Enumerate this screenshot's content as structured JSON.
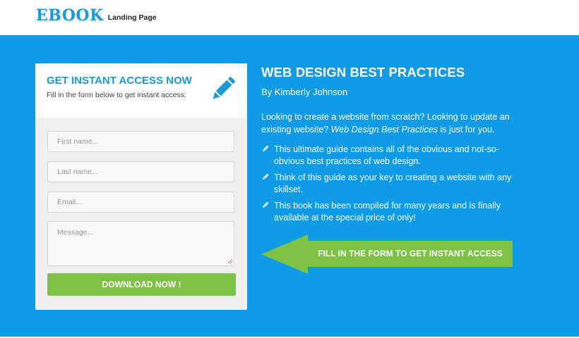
{
  "header": {
    "logo_main": "EBOOK",
    "logo_sub": "Landing Page"
  },
  "form": {
    "title": "GET INSTANT ACCESS NOW",
    "subtitle": "Fill in the form below to get instant access:",
    "first_name_placeholder": "First name...",
    "last_name_placeholder": "Last name...",
    "email_placeholder": "Email...",
    "message_placeholder": "Message...",
    "submit_label": "DOWNLOAD NOW !",
    "icon": "pencil-icon"
  },
  "content": {
    "title": "WEB DESIGN BEST PRACTICES",
    "byline": "By Kimberly Johnson",
    "intro_before": "Looking to create a website from scratch? Looking to update an existing website? ",
    "intro_emphasis": "Web Design Best Practices",
    "intro_after": " is just for you.",
    "bullets": [
      "This ultimate guide contains all of the obvious and not-so-obvious best practices of web design.",
      "Think of this guide as your key to creating a website with any skillset.",
      "This book has been compiled for many years and is finally available at the special price of only!"
    ],
    "bullet_icon": "pencil-icon"
  },
  "cta_arrow": {
    "label": "FILL IN THE FORM TO GET INSTANT ACCESS",
    "icon": "left-arrow-icon"
  },
  "colors": {
    "brand_blue": "#0f9be6",
    "accent_green": "#7dc242",
    "title_blue": "#1a9ad6"
  }
}
